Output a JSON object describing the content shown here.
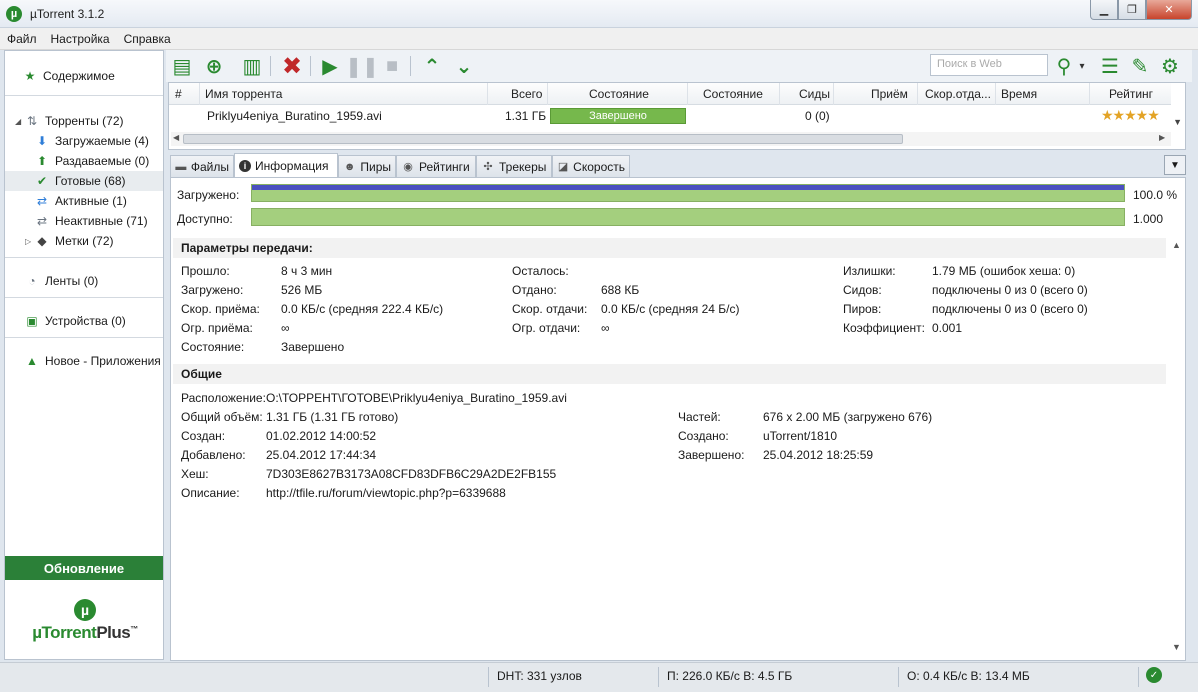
{
  "window": {
    "title": "µTorrent 3.1.2",
    "minimize": "▁",
    "maximize": "❐",
    "close": "✕"
  },
  "menu": [
    "Файл",
    "Настройка",
    "Справка"
  ],
  "sidebar": {
    "items": [
      {
        "label": "Содержимое",
        "icon": "star-icon"
      },
      {
        "label": "Торренты (72)",
        "icon": "torrents-icon"
      },
      {
        "label": "Загружаемые (4)",
        "icon": "download-arrow-icon"
      },
      {
        "label": "Раздаваемые (0)",
        "icon": "upload-arrow-icon"
      },
      {
        "label": "Готовые (68)",
        "icon": "checkmark-icon"
      },
      {
        "label": "Активные (1)",
        "icon": "active-arrows-icon"
      },
      {
        "label": "Неактивные (71)",
        "icon": "inactive-arrows-icon"
      },
      {
        "label": "Метки (72)",
        "icon": "label-tag-icon"
      },
      {
        "label": "Ленты (0)",
        "icon": "rss-feed-icon"
      },
      {
        "label": "Устройства (0)",
        "icon": "device-icon"
      },
      {
        "label": "Новое - Приложения",
        "icon": "apps-icon"
      }
    ],
    "update_button": "Обновление",
    "plus_logo_main": "µTorrent",
    "plus_logo_suffix": "Plus",
    "plus_logo_tm": "™"
  },
  "toolbar": {
    "search_placeholder": "Поиск в Web"
  },
  "list": {
    "columns": [
      "#",
      "Имя торрента",
      "Всего",
      "Состояние",
      "Состояние",
      "Сиды",
      "Приём",
      "Скор.отда...",
      "Время",
      "Рейтинг"
    ],
    "row": {
      "name": "Priklyu4eniya_Buratino_1959.avi",
      "size": "1.31 ГБ",
      "status": "Завершено",
      "seeds": "0 (0)",
      "rating": "★★★★★"
    }
  },
  "tabs": [
    {
      "label": "Файлы",
      "icon": "files-icon"
    },
    {
      "label": "Информация",
      "icon": "info-icon"
    },
    {
      "label": "Пиры",
      "icon": "peers-icon"
    },
    {
      "label": "Рейтинги",
      "icon": "ratings-icon"
    },
    {
      "label": "Трекеры",
      "icon": "trackers-icon"
    },
    {
      "label": "Скорость",
      "icon": "speed-chart-icon"
    }
  ],
  "info": {
    "downloaded_label": "Загружено:",
    "downloaded_value": "100.0 %",
    "downloaded_fraction": 1.0,
    "available_label": "Доступно:",
    "available_value": "1.000",
    "transfer_title": "Параметры передачи:",
    "transfer": {
      "col1": [
        [
          "Прошло:",
          "8 ч 3 мин"
        ],
        [
          "Загружено:",
          "526 МБ"
        ],
        [
          "Скор. приёма:",
          "0.0 КБ/с (средняя 222.4 КБ/с)"
        ],
        [
          "Огр. приёма:",
          "∞"
        ],
        [
          "Состояние:",
          "Завершено"
        ]
      ],
      "col2": [
        [
          "Осталось:",
          ""
        ],
        [
          "Отдано:",
          "688 КБ"
        ],
        [
          "Скор. отдачи:",
          "0.0 КБ/с (средняя 24 Б/с)"
        ],
        [
          "Огр. отдачи:",
          "∞"
        ]
      ],
      "col3": [
        [
          "Излишки:",
          "1.79 МБ (ошибок хеша: 0)"
        ],
        [
          "Сидов:",
          "подключены 0 из 0 (всего 0)"
        ],
        [
          "Пиров:",
          "подключены 0 из 0 (всего 0)"
        ],
        [
          "Коэффициент:",
          "0.001"
        ]
      ]
    },
    "general_title": "Общие",
    "general": {
      "col1": [
        [
          "Расположение:",
          "O:\\ТОРРЕНТ\\ГОТОВЕ\\Priklyu4eniya_Buratino_1959.avi"
        ],
        [
          "Общий объём:",
          "1.31 ГБ (1.31 ГБ готово)"
        ],
        [
          "Создан:",
          "01.02.2012 14:00:52"
        ],
        [
          "Добавлено:",
          "25.04.2012 17:44:34"
        ],
        [
          "Хеш:",
          "7D303E8627B3173A08CFD83DFB6C29A2DE2FB155"
        ],
        [
          "Описание:",
          "http://tfile.ru/forum/viewtopic.php?p=6339688"
        ]
      ],
      "col2": [
        [
          "Частей:",
          "676 x 2.00 МБ (загружено 676)"
        ],
        [
          "Создано:",
          "uTorrent/1810"
        ],
        [
          "Завершено:",
          "25.04.2012 18:25:59"
        ]
      ]
    }
  },
  "status": {
    "dht": "DHT: 331 узлов",
    "download": "П: 226.0 КБ/с В: 4.5 ГБ",
    "upload": "О: 0.4 КБ/с В: 13.4 МБ"
  },
  "colors": {
    "accent_green": "#2a8a30",
    "status_green": "#76b84c",
    "bar_blue": "#4a50c0",
    "star": "#e3a325"
  }
}
